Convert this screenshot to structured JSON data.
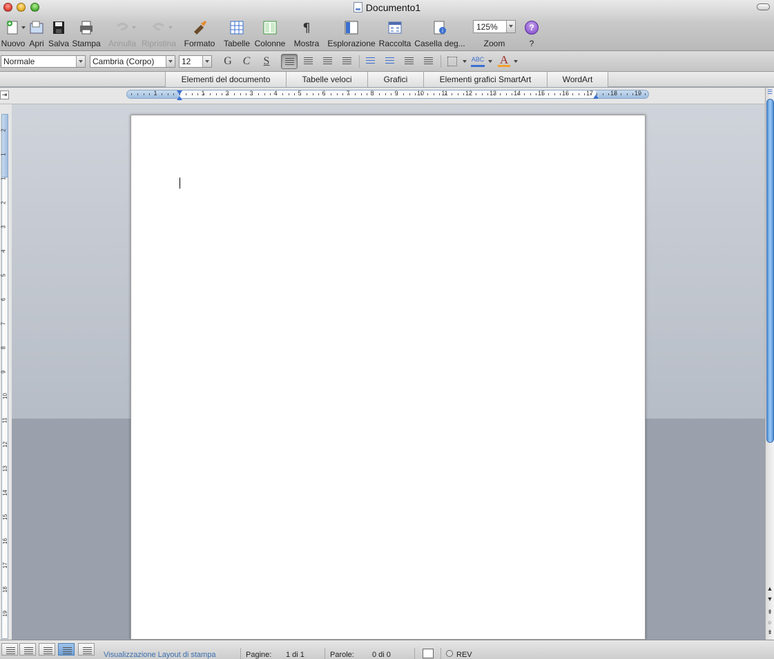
{
  "window": {
    "title": "Documento1"
  },
  "toolbar": {
    "nuovo": "Nuovo",
    "apri": "Apri",
    "salva": "Salva",
    "stampa": "Stampa",
    "annulla": "Annulla",
    "ripristina": "Ripristina",
    "formato": "Formato",
    "tabelle": "Tabelle",
    "colonne": "Colonne",
    "mostra": "Mostra",
    "esplorazione": "Esplorazione",
    "raccolta": "Raccolta",
    "casella": "Casella deg...",
    "zoom_value": "125%",
    "zoom_label": "Zoom",
    "help_label": "?"
  },
  "format_bar": {
    "style": "Normale",
    "font": "Cambria (Corpo)",
    "size": "12",
    "bold": "G",
    "italic": "C",
    "underline": "S"
  },
  "gallery_tabs": [
    "Elementi del documento",
    "Tabelle veloci",
    "Grafici",
    "Elementi grafici SmartArt",
    "WordArt"
  ],
  "ruler": {
    "horizontal": [
      "1",
      "1",
      "2",
      "3",
      "4",
      "5",
      "6",
      "7",
      "8",
      "9",
      "10",
      "11",
      "12",
      "13",
      "14",
      "15",
      "16",
      "17",
      "18",
      "19"
    ],
    "vertical": [
      "2",
      "1",
      "1",
      "2",
      "3",
      "4",
      "5",
      "6",
      "7",
      "8",
      "9",
      "10",
      "11",
      "12",
      "13",
      "14",
      "15",
      "16",
      "17",
      "18",
      "19"
    ]
  },
  "status": {
    "view_name": "Visualizzazione Layout di stampa",
    "pages_label": "Pagine:",
    "pages_value": "1 di 1",
    "words_label": "Parole:",
    "words_value": "0 di 0",
    "rev": "REV"
  },
  "colors": {
    "accent": "#4f8fd8",
    "link": "#3b6fb0"
  }
}
